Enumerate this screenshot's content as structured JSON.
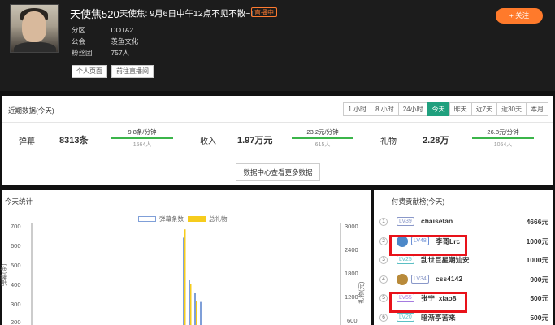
{
  "header": {
    "anchor_name": "天使焦520",
    "room_title": "天使焦: 9月6日中午12点不见不散~!",
    "live_badge": "直播中",
    "info": [
      {
        "key": "分区",
        "value": "DOTA2"
      },
      {
        "key": "公会",
        "value": "羡鱼文化"
      },
      {
        "key": "粉丝团",
        "value": "757人"
      }
    ],
    "profile_button": "个人页面",
    "room_button": "前往直播间",
    "follow_button": "+ 关注"
  },
  "recent": {
    "title": "近期数据(今天)",
    "tabs": [
      {
        "label": "1 小时",
        "active": false
      },
      {
        "label": "8 小时",
        "active": false
      },
      {
        "label": "24小时",
        "active": false
      },
      {
        "label": "今天",
        "active": true
      },
      {
        "label": "昨天",
        "active": false
      },
      {
        "label": "近7天",
        "active": false
      },
      {
        "label": "近30天",
        "active": false
      },
      {
        "label": "本月",
        "active": false
      }
    ],
    "stats": [
      {
        "label": "弹幕",
        "value": "8313条",
        "rate": "9.8条/分钟",
        "count": "1564人"
      },
      {
        "label": "收入",
        "value": "1.97万元",
        "rate": "23.2元/分钟",
        "count": "615人"
      },
      {
        "label": "礼物",
        "value": "2.28万",
        "rate": "26.8元/分钟",
        "count": "1054人"
      }
    ],
    "more_button": "数据中心查看更多数据"
  },
  "today": {
    "title": "今天统计",
    "legend": [
      {
        "label": "弹幕条数",
        "color": "#7f9fd8"
      },
      {
        "label": "总礼物",
        "color": "#f6cc1d"
      }
    ],
    "y_left_ticks": [
      "700",
      "600",
      "500",
      "400",
      "300",
      "200"
    ],
    "y_right_ticks": [
      "3000",
      "2400",
      "1800",
      "1200",
      "600"
    ],
    "y_left_label": "弹幕(条)",
    "y_right_label": "礼物(元)"
  },
  "chart_data": {
    "type": "bar",
    "series": [
      {
        "name": "弹幕条数",
        "values": [
          620,
          330,
          240,
          180
        ]
      },
      {
        "name": "总礼物",
        "values": [
          2900,
          1300,
          800
        ]
      }
    ],
    "ylim_left": [
      0,
      700
    ],
    "ylim_right": [
      0,
      3000
    ]
  },
  "rank": {
    "title": "付费贡献榜(今天)",
    "rows": [
      {
        "rank": "1",
        "level": "LV39",
        "name": "chaisetan",
        "amount": "4666元",
        "lv_color": "#8a98c9",
        "av": "none"
      },
      {
        "rank": "2",
        "level": "LV48",
        "name": "李哥Lrc",
        "amount": "1000元",
        "lv_color": "#6b8fd6",
        "av": "#4c88c8"
      },
      {
        "rank": "3",
        "level": "LV25",
        "name": "乱世巨星潮汕安",
        "amount": "1000元",
        "lv_color": "#5bbfc4",
        "av": "none"
      },
      {
        "rank": "4",
        "level": "LV34",
        "name": "css4142",
        "amount": "900元",
        "lv_color": "#8a98c9",
        "av": "#b88a3a"
      },
      {
        "rank": "5",
        "level": "LV55",
        "name": "张宁_xiao8",
        "amount": "500元",
        "lv_color": "#a57be0",
        "av": "none"
      },
      {
        "rank": "6",
        "level": "LV20",
        "name": "暗渐亭苦来",
        "amount": "500元",
        "lv_color": "#5bbfc4",
        "av": "none"
      }
    ]
  }
}
